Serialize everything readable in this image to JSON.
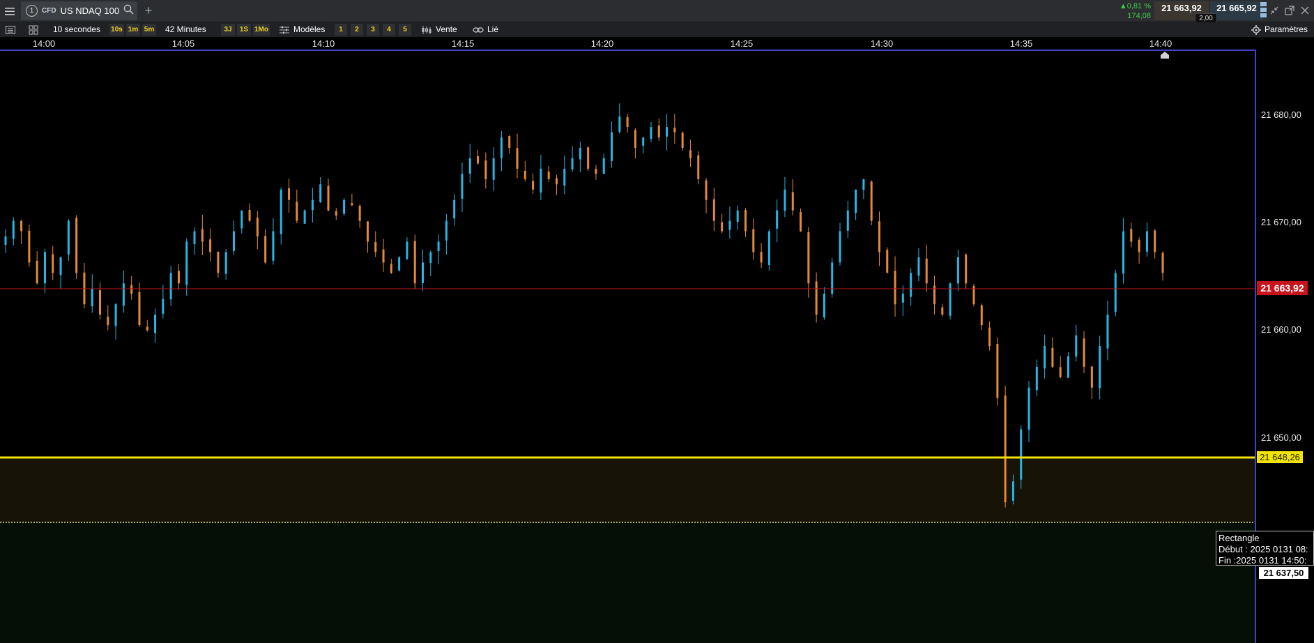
{
  "header": {
    "tab_number": "1",
    "instrument_type": "CFD",
    "instrument_name": "US NDAQ 100",
    "change_pct": "0,81 %",
    "change_abs": "174,08",
    "sell_price": "21 663,92",
    "buy_price": "21 665,92",
    "spread": "2,00",
    "colors": {
      "up": "#3fd04a",
      "sell_bg": "#3b3730",
      "buy_bg": "#2b3a45"
    }
  },
  "toolbar": {
    "interval": "10 secondes",
    "quick_intervals": [
      "10s",
      "1m",
      "5m"
    ],
    "period": "42 Minutes",
    "quick_periods": [
      "3J",
      "1S",
      "1Mo"
    ],
    "templates_label": "Modèles",
    "template_slots": [
      "1",
      "2",
      "3",
      "4",
      "5"
    ],
    "sell_label": "Vente",
    "linked_label": "Lié",
    "settings_label": "Paramètres"
  },
  "chart_data": {
    "type": "candlestick",
    "instrument": "US NDAQ 100",
    "interval": "10 secondes",
    "x_ticks": [
      "14:00",
      "14:05",
      "14:10",
      "14:15",
      "14:20",
      "14:25",
      "14:30",
      "14:35",
      "14:40"
    ],
    "y_ticks": [
      "21 680,00",
      "21 670,00",
      "21 660,00",
      "21 650,00"
    ],
    "ylim": [
      21628.5,
      21685.3
    ],
    "current_price": "21 663,92",
    "horizontal_line": "21 648,26",
    "zone_lower": "21 637,50",
    "colors": {
      "up": "#27b6e6",
      "down": "#e58a3b",
      "current": "#c7141c",
      "level": "#f3e300"
    },
    "start_time": "14:00",
    "closes": [
      21667.5,
      21669,
      21668,
      21665,
      21663,
      21666,
      21664,
      21665.5,
      21669,
      21664,
      21661,
      21662.5,
      21660,
      21659,
      21661,
      21663,
      21662,
      21659,
      21658.5,
      21660,
      21661.5,
      21664,
      21663,
      21667,
      21668,
      21667,
      21666,
      21664,
      21666,
      21668,
      21670,
      21669,
      21667.5,
      21665,
      21668,
      21672,
      21671,
      21669,
      21670,
      21671,
      21672.5,
      21670,
      21669.5,
      21671,
      21670.5,
      21669,
      21667,
      21666,
      21665,
      21664,
      21665.5,
      21667,
      21663,
      21665,
      21666,
      21667,
      21669,
      21671,
      21673.5,
      21675,
      21674.5,
      21673,
      21675,
      21677,
      21676,
      21674,
      21673,
      21672,
      21674,
      21673,
      21672.5,
      21674,
      21675,
      21676,
      21674,
      21673.5,
      21675,
      21677.5,
      21679,
      21678,
      21676,
      21677,
      21678,
      21677,
      21678,
      21677.5,
      21676,
      21675,
      21673,
      21671,
      21669,
      21668,
      21669,
      21670,
      21668,
      21666,
      21665,
      21668,
      21670,
      21672,
      21670,
      21668,
      21663,
      21660,
      21662,
      21665,
      21668,
      21670,
      21672,
      21673,
      21669,
      21666,
      21664,
      21661,
      21662,
      21664,
      21665.5,
      21663,
      21661,
      21660,
      21663,
      21665.5,
      21663,
      21661,
      21659,
      21657,
      21652,
      21642,
      21644,
      21649,
      21653,
      21655,
      21657,
      21655,
      21654,
      21656,
      21658,
      21655,
      21653,
      21657,
      21660,
      21664,
      21668,
      21667,
      21666,
      21668,
      21666,
      21664
    ]
  },
  "tooltip": {
    "title": "Rectangle",
    "start": "Début : 2025 0131 08:",
    "end": "Fin :2025 0131 14:50:"
  }
}
